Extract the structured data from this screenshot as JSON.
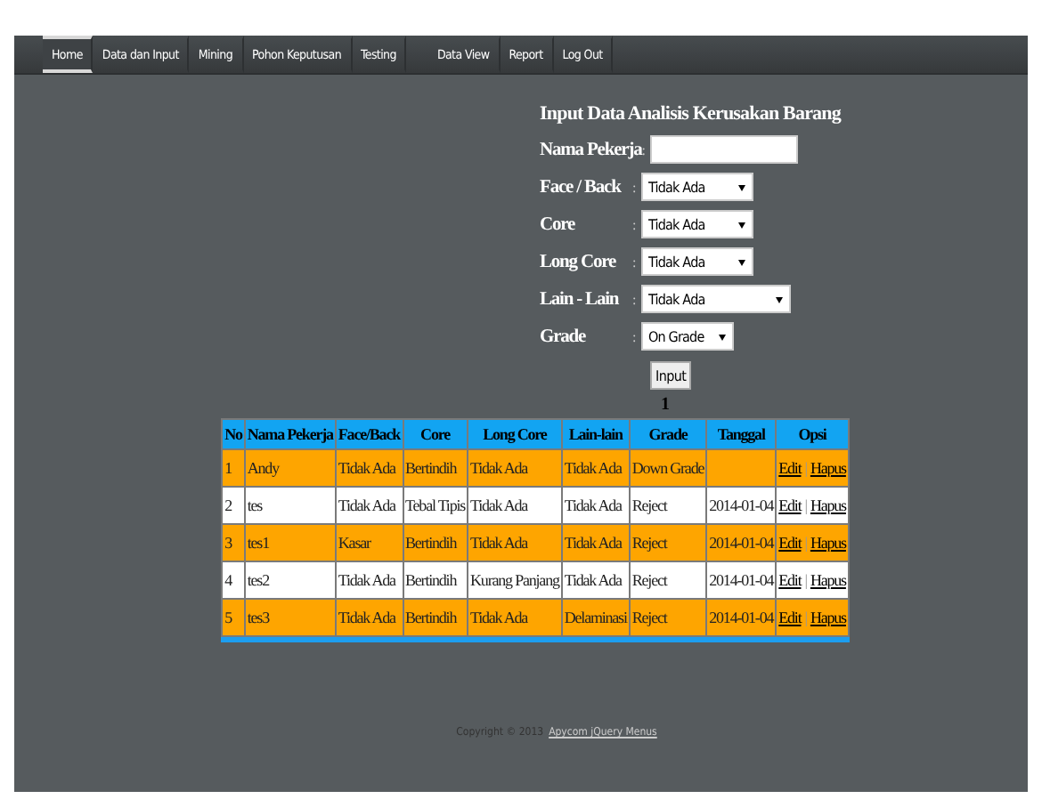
{
  "nav": [
    {
      "label": "Home",
      "selected": true
    },
    {
      "label": "Data dan Input",
      "selected": false
    },
    {
      "label": "Mining",
      "selected": false
    },
    {
      "label": "Pohon Keputusan",
      "selected": false
    },
    {
      "label": "Testing",
      "selected": false
    },
    {
      "label": "Data View",
      "selected": false
    },
    {
      "label": "Report",
      "selected": false
    },
    {
      "label": "Log Out",
      "selected": false
    }
  ],
  "form": {
    "title": "Input Data Analisis Kerusakan Barang",
    "fields": [
      {
        "label": "Nama Pekerja",
        "separator": ":",
        "kind": "text"
      },
      {
        "label": "Face / Back",
        "separator": ":",
        "kind": "select",
        "value": "Tidak Ada"
      },
      {
        "label": "Core",
        "separator": ":",
        "kind": "select",
        "value": "Tidak Ada"
      },
      {
        "label": "Long Core",
        "separator": ":",
        "kind": "select",
        "value": "Tidak Ada"
      },
      {
        "label": "Lain - Lain",
        "separator": ":",
        "kind": "select-wide",
        "value": "Tidak Ada"
      },
      {
        "label": "Grade",
        "separator": ":",
        "kind": "select-short",
        "value": "On Grade"
      }
    ],
    "button": "Input",
    "page": "1"
  },
  "table": {
    "columns": [
      "No",
      "Nama Pekerja",
      "Face/Back",
      "Core",
      "Long Core",
      "Lain-lain",
      "Grade",
      "Tanggal",
      "Opsi"
    ],
    "rows": [
      {
        "cells": [
          "1",
          "Andy",
          "Tidak Ada",
          "Bertindih",
          "Tidak Ada",
          "Tidak Ada",
          "Down Grade",
          ""
        ],
        "edit": "Edit",
        "separator": "|",
        "delete": "Hapus"
      },
      {
        "cells": [
          "2",
          "tes",
          "Tidak Ada",
          "Tebal Tipis",
          "Tidak Ada",
          "Tidak Ada",
          "Reject",
          "2014-01-04"
        ],
        "edit": "Edit",
        "separator": "|",
        "delete": "Hapus"
      },
      {
        "cells": [
          "3",
          "tes1",
          "Kasar",
          "Bertindih",
          "Tidak Ada",
          "Tidak Ada",
          "Reject",
          "2014-01-04"
        ],
        "edit": "Edit",
        "separator": "|",
        "delete": "Hapus"
      },
      {
        "cells": [
          "4",
          "tes2",
          "Tidak Ada",
          "Bertindih",
          "Kurang Panjang",
          "Tidak Ada",
          "Reject",
          "2014-01-04"
        ],
        "edit": "Edit",
        "separator": "|",
        "delete": "Hapus"
      },
      {
        "cells": [
          "5",
          "tes3",
          "Tidak Ada",
          "Bertindih",
          "Tidak Ada",
          "Delaminasi",
          "Reject",
          "2014-01-04"
        ],
        "edit": "Edit",
        "separator": "|",
        "delete": "Hapus"
      }
    ]
  },
  "footer": {
    "text": "Copyright © 2013",
    "link": "Apycom jQuery Menus"
  }
}
